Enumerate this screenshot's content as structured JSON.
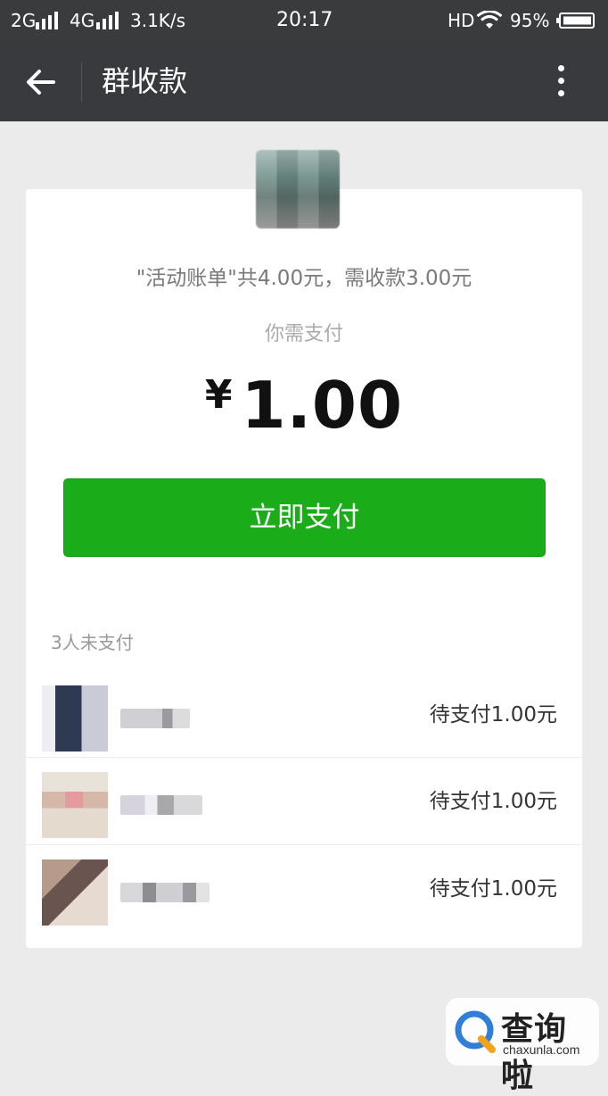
{
  "status_bar": {
    "network_2g": "2G",
    "network_4g": "4G",
    "speed": "3.1K/s",
    "time": "20:17",
    "hd": "HD",
    "battery": "95%"
  },
  "nav": {
    "title": "群收款",
    "back_icon": "back-arrow-icon",
    "more_icon": "more-vertical-icon"
  },
  "bill": {
    "description": "\"活动账单\"共4.00元，需收款3.00元",
    "pay_hint": "你需支付",
    "currency": "¥",
    "amount": "1.00",
    "pay_button_label": "立即支付"
  },
  "unpaid": {
    "count_label": "3人未支付",
    "members": [
      {
        "status": "待支付1.00元"
      },
      {
        "status": "待支付1.00元"
      },
      {
        "status": "待支付1.00元"
      }
    ]
  },
  "watermark": {
    "text": "查询啦",
    "url": "chaxunla.com"
  },
  "colors": {
    "status_bar_bg": "#3a3b3d",
    "nav_bg": "#393a3e",
    "page_bg": "#ebebeb",
    "primary_green": "#1aad19"
  }
}
